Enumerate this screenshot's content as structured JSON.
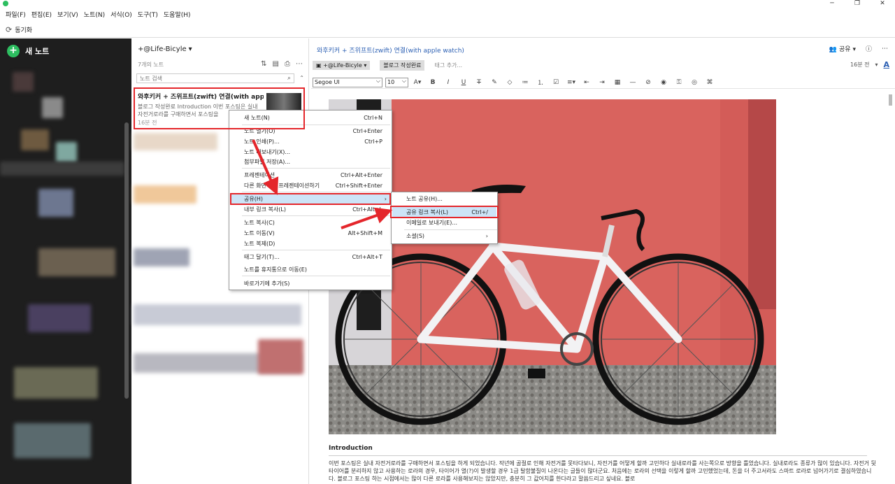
{
  "window": {
    "min_icon": "─",
    "max_icon": "❐",
    "close_icon": "✕"
  },
  "menubar": [
    "파일(F)",
    "편집(E)",
    "보기(V)",
    "노트(N)",
    "서식(O)",
    "도구(T)",
    "도움말(H)"
  ],
  "toolbar": {
    "sync_label": "동기화"
  },
  "sidebar": {
    "new_note_label": "새 노트"
  },
  "notelist": {
    "notebook": "+@Life-Bicyle",
    "count": "7개의 노트",
    "search_placeholder": "노트 검색",
    "note": {
      "title": "와후키커 + 즈위프트(zwift) 연결(with app...",
      "snippet": "블로그 작성완료  Introduction 이번 포스팅은 실내 자전거로라를 구매하면서 포스팅을",
      "date": "16분 전"
    }
  },
  "editor": {
    "title": "와후키커 + 즈위프트(zwift) 연결(with apple watch)",
    "share_label": "공유",
    "notebook_chip": "+@Life-Bicyle",
    "tag": "블로그 작성완료",
    "tag_placeholder": "태그 추가...",
    "modified": "16분 전",
    "font_button": "A",
    "font": "Segoe UI",
    "size": "10",
    "intro_heading": "Introduction",
    "intro_text": "이번 포스팅은 실내 자전거로라를 구매하면서 포스팅을 하게 되었습니다. 작년에 골절로 인해 자전거를 못타다보니, 자전거를 어떻게 할까 고민하다 실내로라를 사는쪽으로 방향을 틀었습니다. 실내로라도 종류가 많이 있습니다. 자전거 뒷 타이어를 분리하지 않고 사용하는 로라의 경우, 타이어가 열(?)이 발생할 경우 1급 탈함불질이 나온다는 글들이 많더군요. 처음에는 로라의 선택을 이렇게 할까 고민했었는데, 돈을 더 주고서라도 스마트 로라로 넘어가기로 결심하였습니다. 블로그 포스팅 하는 시점에서는 많이 다른 로라를 사용해보지는 않았지만, 충분히 그 값어치를 한다라고 말씀드리고 싶네요. 블로"
  },
  "context_menu": [
    {
      "label": "새 노트(N)",
      "shortcut": "Ctrl+N"
    },
    {
      "label": "노트 열기(O)",
      "shortcut": "Ctrl+Enter"
    },
    {
      "label": "노트 인쇄(P)...",
      "shortcut": "Ctrl+P"
    },
    {
      "label": "노트 내보내기(X)...",
      "shortcut": ""
    },
    {
      "label": "첨부파일 저장(A)...",
      "shortcut": ""
    },
    {
      "label": "프레젠테이션",
      "shortcut": "Ctrl+Alt+Enter"
    },
    {
      "label": "다른 화면에서 프레젠테이션하기",
      "shortcut": "Ctrl+Shift+Enter"
    },
    {
      "label": "공유(H)",
      "shortcut": ""
    },
    {
      "label": "내부 링크 복사(L)",
      "shortcut": "Ctrl+Alt+L"
    },
    {
      "label": "노트 복사(C)",
      "shortcut": ""
    },
    {
      "label": "노트 이동(V)",
      "shortcut": "Alt+Shift+M"
    },
    {
      "label": "노트 복제(D)",
      "shortcut": ""
    },
    {
      "label": "태그 달기(T)...",
      "shortcut": "Ctrl+Alt+T"
    },
    {
      "label": "노트를 휴지통으로 이동(E)",
      "shortcut": ""
    },
    {
      "label": "바로가기에 추가(S)",
      "shortcut": ""
    }
  ],
  "share_submenu": [
    {
      "label": "노트 공유(H)...",
      "shortcut": ""
    },
    {
      "label": "공유 링크 복사(L)",
      "shortcut": "Ctrl+/"
    },
    {
      "label": "이메일로 보내기(E)...",
      "shortcut": ""
    },
    {
      "label": "소셜(S)",
      "shortcut": "›"
    }
  ],
  "colors": {
    "accent": "#2dbe60",
    "highlight": "#e4262b",
    "link": "#2b5fb3",
    "menu_active": "#cce4f7"
  }
}
